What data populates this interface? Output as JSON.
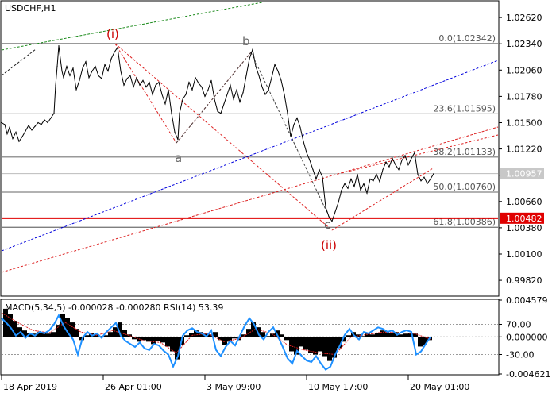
{
  "chart_data": {
    "type": "line",
    "symbol": "USDCHF,H1",
    "x_labels": [
      "18 Apr 2019",
      "26 Apr 01:00",
      "3 May 09:00",
      "10 May 17:00",
      "20 May 01:00"
    ],
    "price_axis": {
      "ticks": [
        "1.02620",
        "1.02340",
        "1.02060",
        "1.01780",
        "1.01500",
        "1.01220",
        "1.00940",
        "1.00660",
        "1.00380",
        "1.00100",
        "0.99820"
      ],
      "ylim": [
        0.9966,
        1.0279
      ]
    },
    "current_price": "1.00957",
    "support_level": "1.00482",
    "fibonacci_levels": [
      {
        "label": "0.0(1.02342)",
        "value": 1.02342
      },
      {
        "label": "23.6(1.01595)",
        "value": 1.01595
      },
      {
        "label": "38.2(1.01133)",
        "value": 1.01133
      },
      {
        "label": "50.0(1.00760)",
        "value": 1.0076
      },
      {
        "label": "61.8(1.00386)",
        "value": 1.00386
      }
    ],
    "wave_labels": [
      "(i)",
      "a",
      "b",
      "c",
      "(ii)"
    ],
    "price_series": [
      [
        0,
        1.015
      ],
      [
        4,
        1.0148
      ],
      [
        7,
        1.0138
      ],
      [
        10,
        1.0145
      ],
      [
        14,
        1.0133
      ],
      [
        18,
        1.014
      ],
      [
        22,
        1.013
      ],
      [
        26,
        1.0135
      ],
      [
        30,
        1.0141
      ],
      [
        34,
        1.0147
      ],
      [
        38,
        1.0142
      ],
      [
        42,
        1.0146
      ],
      [
        46,
        1.015
      ],
      [
        50,
        1.0148
      ],
      [
        54,
        1.0153
      ],
      [
        58,
        1.015
      ],
      [
        62,
        1.0155
      ],
      [
        66,
        1.016
      ],
      [
        68,
        1.019
      ],
      [
        70,
        1.021
      ],
      [
        72,
        1.0232
      ],
      [
        74,
        1.0218
      ],
      [
        76,
        1.0205
      ],
      [
        78,
        1.0198
      ],
      [
        82,
        1.021
      ],
      [
        86,
        1.02
      ],
      [
        90,
        1.0208
      ],
      [
        94,
        1.0185
      ],
      [
        98,
        1.0195
      ],
      [
        102,
        1.0208
      ],
      [
        106,
        1.0215
      ],
      [
        110,
        1.0198
      ],
      [
        114,
        1.0205
      ],
      [
        118,
        1.021
      ],
      [
        122,
        1.02
      ],
      [
        126,
        1.0197
      ],
      [
        130,
        1.0212
      ],
      [
        134,
        1.0205
      ],
      [
        138,
        1.0218
      ],
      [
        142,
        1.0225
      ],
      [
        146,
        1.023
      ],
      [
        150,
        1.0205
      ],
      [
        154,
        1.019
      ],
      [
        158,
        1.0197
      ],
      [
        162,
        1.02
      ],
      [
        166,
        1.0188
      ],
      [
        170,
        1.0198
      ],
      [
        174,
        1.019
      ],
      [
        178,
        1.0195
      ],
      [
        182,
        1.0188
      ],
      [
        186,
        1.0193
      ],
      [
        190,
        1.018
      ],
      [
        194,
        1.019
      ],
      [
        198,
        1.0193
      ],
      [
        202,
        1.018
      ],
      [
        206,
        1.017
      ],
      [
        210,
        1.0185
      ],
      [
        214,
        1.016
      ],
      [
        218,
        1.014
      ],
      [
        222,
        1.0132
      ],
      [
        224,
        1.016
      ],
      [
        228,
        1.0175
      ],
      [
        232,
        1.018
      ],
      [
        236,
        1.0193
      ],
      [
        240,
        1.0185
      ],
      [
        244,
        1.0198
      ],
      [
        248,
        1.0192
      ],
      [
        252,
        1.0188
      ],
      [
        256,
        1.0178
      ],
      [
        260,
        1.0185
      ],
      [
        264,
        1.0195
      ],
      [
        268,
        1.0175
      ],
      [
        272,
        1.0162
      ],
      [
        276,
        1.016
      ],
      [
        280,
        1.017
      ],
      [
        284,
        1.018
      ],
      [
        288,
        1.019
      ],
      [
        292,
        1.0175
      ],
      [
        296,
        1.0185
      ],
      [
        300,
        1.0172
      ],
      [
        304,
        1.0182
      ],
      [
        308,
        1.02
      ],
      [
        312,
        1.0218
      ],
      [
        316,
        1.0228
      ],
      [
        320,
        1.021
      ],
      [
        324,
        1.02
      ],
      [
        328,
        1.0188
      ],
      [
        332,
        1.018
      ],
      [
        336,
        1.0185
      ],
      [
        340,
        1.0198
      ],
      [
        344,
        1.0212
      ],
      [
        348,
        1.0205
      ],
      [
        352,
        1.0195
      ],
      [
        356,
        1.018
      ],
      [
        360,
        1.016
      ],
      [
        364,
        1.0135
      ],
      [
        368,
        1.0148
      ],
      [
        372,
        1.0155
      ],
      [
        376,
        1.0145
      ],
      [
        380,
        1.013
      ],
      [
        384,
        1.0118
      ],
      [
        388,
        1.011
      ],
      [
        392,
        1.01
      ],
      [
        396,
        1.009
      ],
      [
        400,
        1.01
      ],
      [
        404,
        1.0092
      ],
      [
        408,
        1.006
      ],
      [
        412,
        1.005
      ],
      [
        416,
        1.0045
      ],
      [
        420,
        1.0055
      ],
      [
        424,
        1.0065
      ],
      [
        428,
        1.0078
      ],
      [
        432,
        1.0085
      ],
      [
        436,
        1.008
      ],
      [
        440,
        1.009
      ],
      [
        444,
        1.0082
      ],
      [
        448,
        1.0095
      ],
      [
        452,
        1.0078
      ],
      [
        456,
        1.0085
      ],
      [
        460,
        1.0075
      ],
      [
        464,
        1.009
      ],
      [
        468,
        1.0088
      ],
      [
        472,
        1.0095
      ],
      [
        476,
        1.0087
      ],
      [
        480,
        1.01
      ],
      [
        484,
        1.0108
      ],
      [
        488,
        1.0103
      ],
      [
        492,
        1.0112
      ],
      [
        496,
        1.0105
      ],
      [
        500,
        1.01
      ],
      [
        504,
        1.011
      ],
      [
        508,
        1.0115
      ],
      [
        512,
        1.0105
      ],
      [
        516,
        1.0112
      ],
      [
        520,
        1.0118
      ],
      [
        524,
        1.0095
      ],
      [
        528,
        1.0088
      ],
      [
        532,
        1.0092
      ],
      [
        536,
        1.0085
      ],
      [
        540,
        1.009
      ],
      [
        544,
        1.00957
      ]
    ],
    "indicator": {
      "header": "MACD(5,34,5) -0.000028 -0.000280 RSI(14) 53.39",
      "ticks": [
        "0.004579",
        "70.00",
        "0.000000",
        "-30.00",
        "-0.004621"
      ],
      "ylim": [
        -0.004621,
        0.004579
      ],
      "histogram": [
        [
          2,
          0.0035
        ],
        [
          8,
          0.0028
        ],
        [
          14,
          0.002
        ],
        [
          20,
          0.0012
        ],
        [
          26,
          0.0008
        ],
        [
          32,
          0.0005
        ],
        [
          38,
          0.0004
        ],
        [
          44,
          0.0006
        ],
        [
          50,
          0.0005
        ],
        [
          56,
          0.0004
        ],
        [
          62,
          0.0006
        ],
        [
          68,
          0.0015
        ],
        [
          74,
          0.0028
        ],
        [
          80,
          0.0024
        ],
        [
          86,
          0.0018
        ],
        [
          92,
          0.001
        ],
        [
          98,
          -0.0004
        ],
        [
          104,
          0.0002
        ],
        [
          110,
          0.0005
        ],
        [
          116,
          0.0003
        ],
        [
          122,
          0.0001
        ],
        [
          128,
          0.0002
        ],
        [
          134,
          0.0006
        ],
        [
          140,
          0.0012
        ],
        [
          146,
          0.0018
        ],
        [
          152,
          0.0009
        ],
        [
          158,
          0.0003
        ],
        [
          164,
          -0.0003
        ],
        [
          170,
          -0.0006
        ],
        [
          176,
          -0.0004
        ],
        [
          182,
          -0.0006
        ],
        [
          188,
          -0.0009
        ],
        [
          194,
          -0.0005
        ],
        [
          200,
          -0.0007
        ],
        [
          206,
          -0.0012
        ],
        [
          212,
          -0.0018
        ],
        [
          218,
          -0.0028
        ],
        [
          224,
          -0.001
        ],
        [
          230,
          0.0002
        ],
        [
          236,
          0.0005
        ],
        [
          242,
          0.0008
        ],
        [
          248,
          0.0006
        ],
        [
          254,
          0.0004
        ],
        [
          260,
          0.0003
        ],
        [
          266,
          0.0006
        ],
        [
          272,
          -0.0004
        ],
        [
          278,
          -0.001
        ],
        [
          284,
          -0.0006
        ],
        [
          290,
          -0.0002
        ],
        [
          296,
          -0.0004
        ],
        [
          302,
          0.0003
        ],
        [
          308,
          0.001
        ],
        [
          314,
          0.0018
        ],
        [
          320,
          0.0012
        ],
        [
          326,
          0.0006
        ],
        [
          332,
          0.0001
        ],
        [
          338,
          0.0004
        ],
        [
          344,
          0.0008
        ],
        [
          350,
          0.0003
        ],
        [
          356,
          -0.0004
        ],
        [
          362,
          -0.0018
        ],
        [
          368,
          -0.0022
        ],
        [
          374,
          -0.0012
        ],
        [
          380,
          -0.0016
        ],
        [
          386,
          -0.002
        ],
        [
          392,
          -0.0022
        ],
        [
          398,
          -0.0018
        ],
        [
          404,
          -0.0024
        ],
        [
          410,
          -0.003
        ],
        [
          416,
          -0.0026
        ],
        [
          422,
          -0.0014
        ],
        [
          428,
          -0.0006
        ],
        [
          434,
          0.0002
        ],
        [
          440,
          0.0006
        ],
        [
          446,
          0.0003
        ],
        [
          452,
          0.0001
        ],
        [
          458,
          0.0004
        ],
        [
          464,
          0.0003
        ],
        [
          470,
          0.0005
        ],
        [
          476,
          0.0008
        ],
        [
          482,
          0.0007
        ],
        [
          488,
          0.0005
        ],
        [
          494,
          0.0006
        ],
        [
          500,
          0.0003
        ],
        [
          506,
          0.0004
        ],
        [
          512,
          0.0005
        ],
        [
          518,
          0.0004
        ],
        [
          524,
          -0.0012
        ],
        [
          530,
          -0.001
        ],
        [
          536,
          -0.0004
        ],
        [
          542,
          -3e-05
        ]
      ],
      "rsi": [
        [
          0,
          78
        ],
        [
          6,
          72
        ],
        [
          12,
          65
        ],
        [
          18,
          55
        ],
        [
          24,
          60
        ],
        [
          30,
          52
        ],
        [
          36,
          58
        ],
        [
          42,
          55
        ],
        [
          48,
          60
        ],
        [
          54,
          58
        ],
        [
          60,
          62
        ],
        [
          66,
          70
        ],
        [
          72,
          82
        ],
        [
          78,
          68
        ],
        [
          84,
          58
        ],
        [
          90,
          50
        ],
        [
          96,
          30
        ],
        [
          102,
          52
        ],
        [
          108,
          60
        ],
        [
          114,
          55
        ],
        [
          120,
          58
        ],
        [
          126,
          52
        ],
        [
          132,
          60
        ],
        [
          138,
          66
        ],
        [
          144,
          72
        ],
        [
          150,
          55
        ],
        [
          156,
          48
        ],
        [
          162,
          44
        ],
        [
          168,
          40
        ],
        [
          174,
          46
        ],
        [
          180,
          38
        ],
        [
          186,
          36
        ],
        [
          192,
          44
        ],
        [
          198,
          42
        ],
        [
          204,
          35
        ],
        [
          210,
          30
        ],
        [
          216,
          14
        ],
        [
          222,
          28
        ],
        [
          228,
          55
        ],
        [
          234,
          62
        ],
        [
          240,
          65
        ],
        [
          246,
          60
        ],
        [
          252,
          58
        ],
        [
          258,
          54
        ],
        [
          264,
          62
        ],
        [
          270,
          36
        ],
        [
          276,
          28
        ],
        [
          282,
          40
        ],
        [
          288,
          48
        ],
        [
          294,
          42
        ],
        [
          300,
          55
        ],
        [
          306,
          68
        ],
        [
          312,
          78
        ],
        [
          318,
          70
        ],
        [
          324,
          56
        ],
        [
          330,
          50
        ],
        [
          336,
          60
        ],
        [
          342,
          66
        ],
        [
          348,
          54
        ],
        [
          354,
          40
        ],
        [
          360,
          25
        ],
        [
          366,
          18
        ],
        [
          372,
          35
        ],
        [
          378,
          28
        ],
        [
          384,
          22
        ],
        [
          390,
          20
        ],
        [
          396,
          28
        ],
        [
          402,
          18
        ],
        [
          408,
          10
        ],
        [
          414,
          14
        ],
        [
          420,
          30
        ],
        [
          426,
          42
        ],
        [
          432,
          56
        ],
        [
          438,
          64
        ],
        [
          444,
          55
        ],
        [
          450,
          50
        ],
        [
          456,
          60
        ],
        [
          462,
          58
        ],
        [
          468,
          62
        ],
        [
          474,
          66
        ],
        [
          480,
          64
        ],
        [
          486,
          60
        ],
        [
          492,
          62
        ],
        [
          498,
          56
        ],
        [
          504,
          60
        ],
        [
          510,
          62
        ],
        [
          516,
          60
        ],
        [
          522,
          30
        ],
        [
          528,
          34
        ],
        [
          534,
          44
        ],
        [
          540,
          53.39
        ]
      ],
      "macd_signal": [
        [
          0,
          0.003
        ],
        [
          20,
          0.0018
        ],
        [
          40,
          0.0008
        ],
        [
          60,
          0.0005
        ],
        [
          80,
          0.0018
        ],
        [
          100,
          0.0006
        ],
        [
          120,
          0.0002
        ],
        [
          140,
          0.0008
        ],
        [
          160,
          0.0002
        ],
        [
          180,
          -0.0005
        ],
        [
          200,
          -0.0007
        ],
        [
          220,
          -0.002
        ],
        [
          240,
          0.0002
        ],
        [
          260,
          0.0004
        ],
        [
          280,
          -0.0006
        ],
        [
          300,
          -0.0002
        ],
        [
          320,
          0.001
        ],
        [
          340,
          0.0004
        ],
        [
          360,
          -0.001
        ],
        [
          380,
          -0.0016
        ],
        [
          400,
          -0.002
        ],
        [
          420,
          -0.0022
        ],
        [
          440,
          0.0
        ],
        [
          460,
          0.0003
        ],
        [
          480,
          0.0006
        ],
        [
          500,
          0.0005
        ],
        [
          520,
          0.0004
        ],
        [
          540,
          -0.00028
        ]
      ]
    }
  }
}
